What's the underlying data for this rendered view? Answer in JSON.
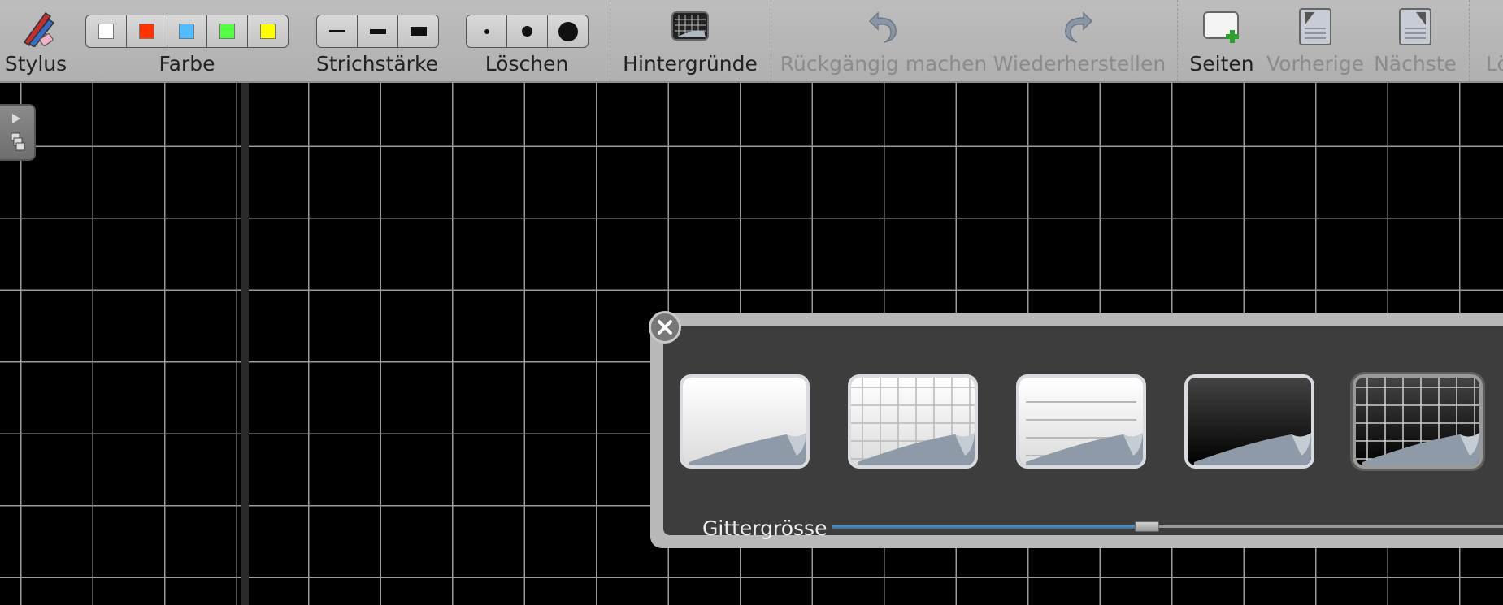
{
  "toolbar": {
    "stylus": {
      "label": "Stylus",
      "icon": "stylus-icon"
    },
    "color": {
      "label": "Farbe",
      "swatches": [
        "#ffffff",
        "#ff3300",
        "#55bbff",
        "#55ff44",
        "#ffff00"
      ]
    },
    "stroke": {
      "label": "Strichstärke"
    },
    "erase": {
      "label": "Löschen"
    },
    "backgrounds": {
      "label": "Hintergründe",
      "icon": "backgrounds-icon"
    },
    "undo": {
      "label": "Rückgängig machen",
      "icon": "undo-icon",
      "enabled": false
    },
    "redo": {
      "label": "Wiederherstellen",
      "icon": "redo-icon",
      "enabled": false
    },
    "pages": {
      "label": "Seiten",
      "icon": "new-page-icon"
    },
    "previous": {
      "label": "Vorherige",
      "icon": "previous-page-icon",
      "enabled": false
    },
    "next": {
      "label": "Nächste",
      "icon": "next-page-icon",
      "enabled": false
    },
    "clear": {
      "label": "Lö",
      "enabled": false
    }
  },
  "background_palette": {
    "grid_size_label": "Gittergrösse",
    "grid_size_fraction": 0.45,
    "options": [
      {
        "name": "white-plain",
        "selected": false
      },
      {
        "name": "white-grid",
        "selected": false
      },
      {
        "name": "white-lined",
        "selected": false
      },
      {
        "name": "black-plain",
        "selected": false
      },
      {
        "name": "black-grid",
        "selected": true
      }
    ]
  }
}
